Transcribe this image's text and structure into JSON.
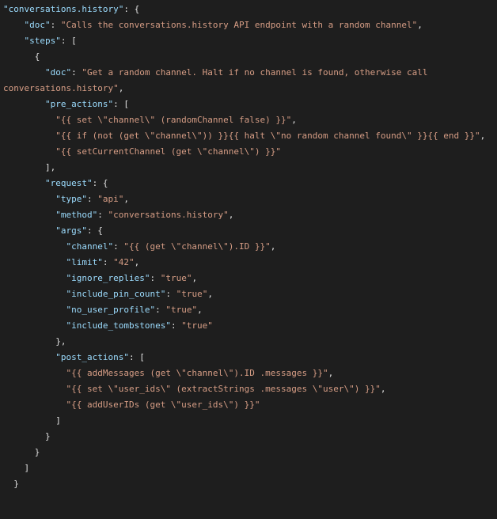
{
  "code": {
    "root_key": "\"conversations.history\"",
    "doc_key": "\"doc\"",
    "doc_val": "\"Calls the conversations.history API endpoint with a random channel\"",
    "steps_key": "\"steps\"",
    "step_doc_key": "\"doc\"",
    "step_doc_val": "\"Get a random channel. Halt if no channel is found, otherwise call conversations.history\"",
    "pre_actions_key": "\"pre_actions\"",
    "pre_action_0": "\"{{ set \\\"channel\\\" (randomChannel false) }}\"",
    "pre_action_1": "\"{{ if (not (get \\\"channel\\\")) }}{{ halt \\\"no random channel found\\\" }}{{ end }}\"",
    "pre_action_2": "\"{{ setCurrentChannel (get \\\"channel\\\") }}\"",
    "request_key": "\"request\"",
    "type_key": "\"type\"",
    "type_val": "\"api\"",
    "method_key": "\"method\"",
    "method_val": "\"conversations.history\"",
    "args_key": "\"args\"",
    "arg_channel_key": "\"channel\"",
    "arg_channel_val": "\"{{ (get \\\"channel\\\").ID }}\"",
    "arg_limit_key": "\"limit\"",
    "arg_limit_val": "\"42\"",
    "arg_ignore_key": "\"ignore_replies\"",
    "arg_ignore_val": "\"true\"",
    "arg_pin_key": "\"include_pin_count\"",
    "arg_pin_val": "\"true\"",
    "arg_noprof_key": "\"no_user_profile\"",
    "arg_noprof_val": "\"true\"",
    "arg_tomb_key": "\"include_tombstones\"",
    "arg_tomb_val": "\"true\"",
    "post_actions_key": "\"post_actions\"",
    "post_action_0": "\"{{ addMessages (get \\\"channel\\\").ID .messages }}\"",
    "post_action_1": "\"{{ set \\\"user_ids\\\" (extractStrings .messages \\\"user\\\") }}\"",
    "post_action_2": "\"{{ addUserIDs (get \\\"user_ids\\\") }}\""
  }
}
